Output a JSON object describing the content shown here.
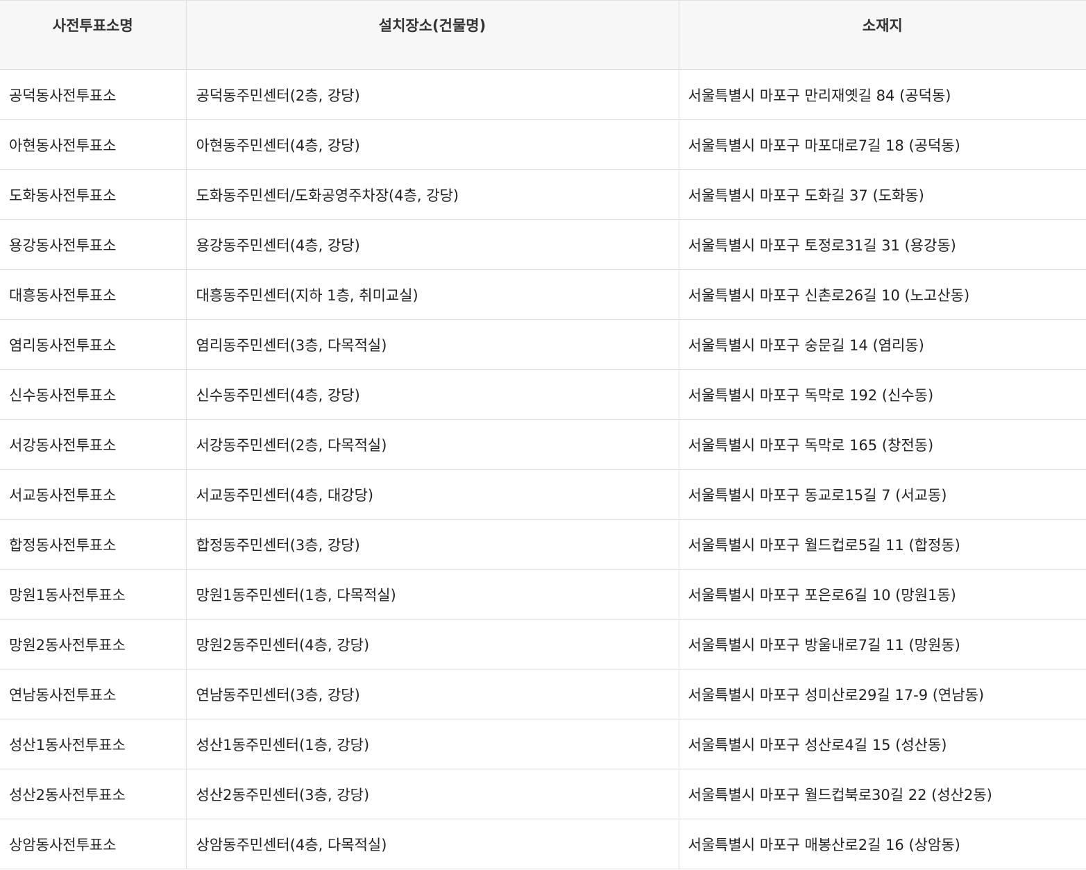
{
  "table": {
    "headers": [
      "사전투표소명",
      "설치장소(건물명)",
      "소재지"
    ],
    "rows": [
      [
        "공덕동사전투표소",
        "공덕동주민센터(2층, 강당)",
        "서울특별시 마포구 만리재옛길 84 (공덕동)"
      ],
      [
        "아현동사전투표소",
        "아현동주민센터(4층, 강당)",
        "서울특별시 마포구 마포대로7길 18 (공덕동)"
      ],
      [
        "도화동사전투표소",
        "도화동주민센터/도화공영주차장(4층, 강당)",
        "서울특별시 마포구 도화길 37 (도화동)"
      ],
      [
        "용강동사전투표소",
        "용강동주민센터(4층, 강당)",
        "서울특별시 마포구 토정로31길 31 (용강동)"
      ],
      [
        "대흥동사전투표소",
        "대흥동주민센터(지하 1층, 취미교실)",
        "서울특별시 마포구 신촌로26길 10 (노고산동)"
      ],
      [
        "염리동사전투표소",
        "염리동주민센터(3층, 다목적실)",
        "서울특별시 마포구 숭문길 14 (염리동)"
      ],
      [
        "신수동사전투표소",
        "신수동주민센터(4층, 강당)",
        "서울특별시 마포구 독막로 192 (신수동)"
      ],
      [
        "서강동사전투표소",
        "서강동주민센터(2층, 다목적실)",
        "서울특별시 마포구 독막로 165 (창전동)"
      ],
      [
        "서교동사전투표소",
        "서교동주민센터(4층, 대강당)",
        "서울특별시 마포구 동교로15길 7 (서교동)"
      ],
      [
        "합정동사전투표소",
        "합정동주민센터(3층, 강당)",
        "서울특별시 마포구 월드컵로5길 11 (합정동)"
      ],
      [
        "망원1동사전투표소",
        "망원1동주민센터(1층, 다목적실)",
        "서울특별시 마포구 포은로6길 10 (망원1동)"
      ],
      [
        "망원2동사전투표소",
        "망원2동주민센터(4층, 강당)",
        "서울특별시 마포구 방울내로7길 11 (망원동)"
      ],
      [
        "연남동사전투표소",
        "연남동주민센터(3층, 강당)",
        "서울특별시 마포구 성미산로29길 17-9 (연남동)"
      ],
      [
        "성산1동사전투표소",
        "성산1동주민센터(1층, 강당)",
        "서울특별시 마포구 성산로4길 15 (성산동)"
      ],
      [
        "성산2동사전투표소",
        "성산2동주민센터(3층, 강당)",
        "서울특별시 마포구 월드컵북로30길 22 (성산2동)"
      ],
      [
        "상암동사전투표소",
        "상암동주민센터(4층, 다목적실)",
        "서울특별시 마포구 매봉산로2길 16 (상암동)"
      ]
    ]
  }
}
